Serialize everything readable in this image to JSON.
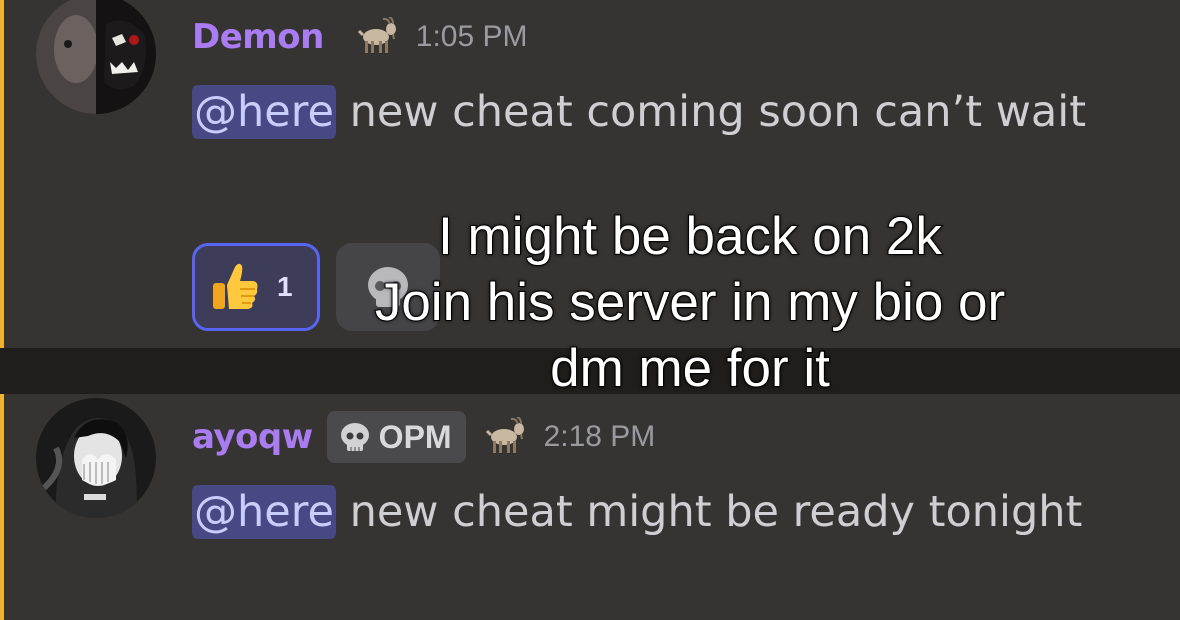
{
  "messages": [
    {
      "username": "Demon",
      "badge_icon": "goat-icon",
      "timestamp": "1:05 PM",
      "mention": "@here",
      "text": " new cheat coming soon can’t wait",
      "reactions": [
        {
          "icon": "thumbs-up-icon",
          "count": "1"
        },
        {
          "icon": "skull-icon",
          "count": ""
        }
      ]
    },
    {
      "username": "ayoqw",
      "tag_icon": "skull-icon",
      "tag_label": "OPM",
      "badge_icon": "goat-icon",
      "timestamp": "2:18 PM",
      "mention": "@here",
      "text": " new cheat might be ready tonight"
    }
  ],
  "overlay_caption": {
    "line1": "I might be back on 2k",
    "line2": "Join his server in my bio or",
    "line3": "dm me for it"
  },
  "colors": {
    "background": "#363432",
    "mention_bar": "#f0b232",
    "username": "#a97cf2",
    "mention_bg": "#474884",
    "reaction_border": "#5865f2"
  }
}
